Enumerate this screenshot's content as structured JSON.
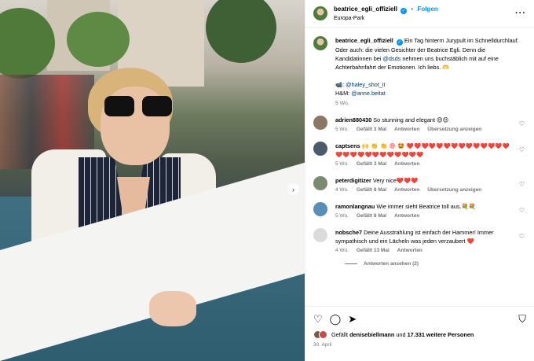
{
  "post": {
    "username": "beatrice_egli_offiziell",
    "verified_mark": "✓",
    "separator": "•",
    "follow_label": "Folgen",
    "location": "Europa-Park",
    "more_label": "···"
  },
  "caption": {
    "username": "beatrice_egli_offiziell",
    "text_1": "Ein Tag hinterm Jurypult im Schnelldurchlauf. Oder auch: die vielen Gesichter der Beatrice Egli. Denn die Kandidatinnen bei",
    "mention_1": "@dsds",
    "text_2": "nehmen uns buchstäblich mit auf eine Achterbahnfahrt der Emotionen. Ich liebs. 🫶",
    "credit_1_prefix": "📹:",
    "credit_1_handle": "@haley_shot_it",
    "credit_2_prefix": "H&M:",
    "credit_2_handle": "@anne.beitat",
    "time": "5 Wo."
  },
  "comments": [
    {
      "user": "adrien880430",
      "text": "So stunning and elegant 😍😍",
      "time": "5 Wo.",
      "likes": "Gefällt 3 Mal",
      "reply": "Antworten",
      "translate": "Übersetzung anzeigen",
      "color": "#8a7766"
    },
    {
      "user": "captsens",
      "text": "🙌 👏 👏 😍 🤩 ❤️❤️❤️❤️❤️❤️❤️❤️❤️❤️❤️❤️❤️❤️❤️❤️❤️❤️❤️❤️❤️❤️❤️❤️❤️❤️",
      "time": "5 Wo.",
      "likes": "Gefällt 3 Mal",
      "reply": "Antworten",
      "translate": "",
      "color": "#4a5c6a"
    },
    {
      "user": "peterdigitizer",
      "text": "Very nice❤️❤️❤️",
      "time": "4 Wo.",
      "likes": "Gefällt 8 Mal",
      "reply": "Antworten",
      "translate": "Übersetzung anzeigen",
      "color": "#7b8a70"
    },
    {
      "user": "ramonlangnau",
      "text": "Wie immer sieht Beatrice toll aus.💐💐",
      "time": "5 Wo.",
      "likes": "Gefällt 8 Mal",
      "reply": "Antworten",
      "translate": "",
      "color": "#5a8fb5"
    },
    {
      "user": "nobsche7",
      "text": "Deine Ausstrahlung ist einfach der Hammer! Immer sympathisch und ein Lächeln was jeden verzaubert ❤️",
      "time": "4 Wo.",
      "likes": "Gefällt 13 Mal",
      "reply": "Antworten",
      "translate": "",
      "color": "#dbdbdb"
    }
  ],
  "show_replies": "Antworten ansehen (2)",
  "footer": {
    "likes_prefix": "Gefällt",
    "likes_user": "denisebiellmann",
    "likes_middle": "und",
    "likes_count": "17.331 weitere Personen",
    "date": "30. April"
  },
  "icons": {
    "like": "heart-icon",
    "comment": "comment-icon",
    "share": "share-icon",
    "save": "bookmark-icon",
    "next": "chevron-right-icon"
  },
  "colors": {
    "accent": "#0095f6",
    "muted": "#737373",
    "link": "#00376b"
  }
}
